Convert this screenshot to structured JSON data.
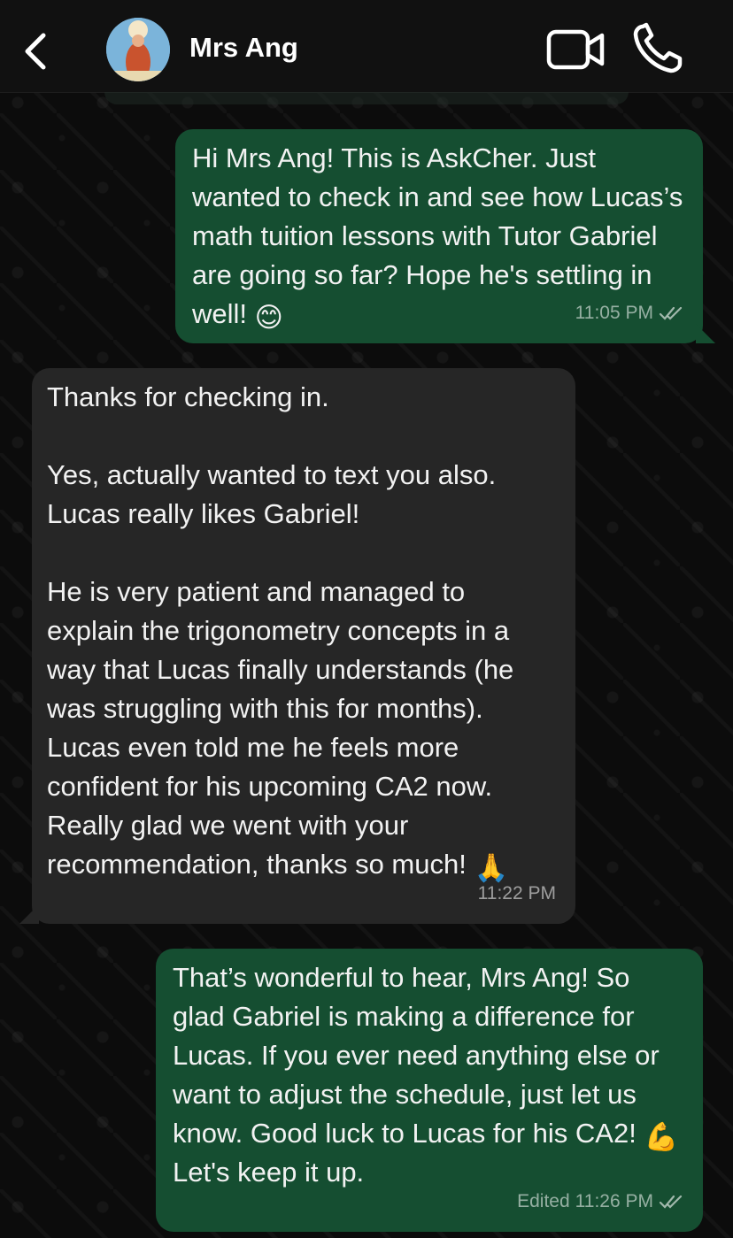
{
  "header": {
    "back_icon": "chevron-left-icon",
    "contact_name": "Mrs Ang",
    "video_icon": "video-camera-icon",
    "call_icon": "phone-icon"
  },
  "messages": [
    {
      "direction": "out",
      "text": "Hi Mrs Ang! This is AskCher. Just wanted to check in and see how Lucas’s math tuition lessons with Tutor Gabriel are going so far? Hope he's settling in well!",
      "emoji": "😊",
      "time": "11:05 PM",
      "edited": "",
      "status_icon": "double-check-icon"
    },
    {
      "direction": "in",
      "paragraph1": "Thanks for checking in.",
      "paragraph2": "Yes, actually wanted to text you also.\nLucas really likes Gabriel!",
      "paragraph3": "He is very patient and managed to explain the trigonometry concepts in a way that Lucas finally understands (he was struggling with this for months). Lucas even told me he feels more confident for his upcoming CA2 now. Really glad we went with your recommendation, thanks so much!",
      "emoji": "🙏",
      "time": "11:22 PM"
    },
    {
      "direction": "out",
      "text_before": "That’s wonderful to hear, Mrs Ang! So glad Gabriel is making a difference for Lucas. If you ever need anything else or want to adjust the schedule, just let us know. Good luck to Lucas for his CA2!",
      "emoji": "💪",
      "text_after": "Let's keep it up.",
      "time": "11:26 PM",
      "edited": "Edited",
      "status_icon": "double-check-icon"
    }
  ],
  "colors": {
    "outgoing_bubble": "#154e31",
    "incoming_bubble": "#262626",
    "background": "#0c0c0c",
    "header": "#111111"
  }
}
